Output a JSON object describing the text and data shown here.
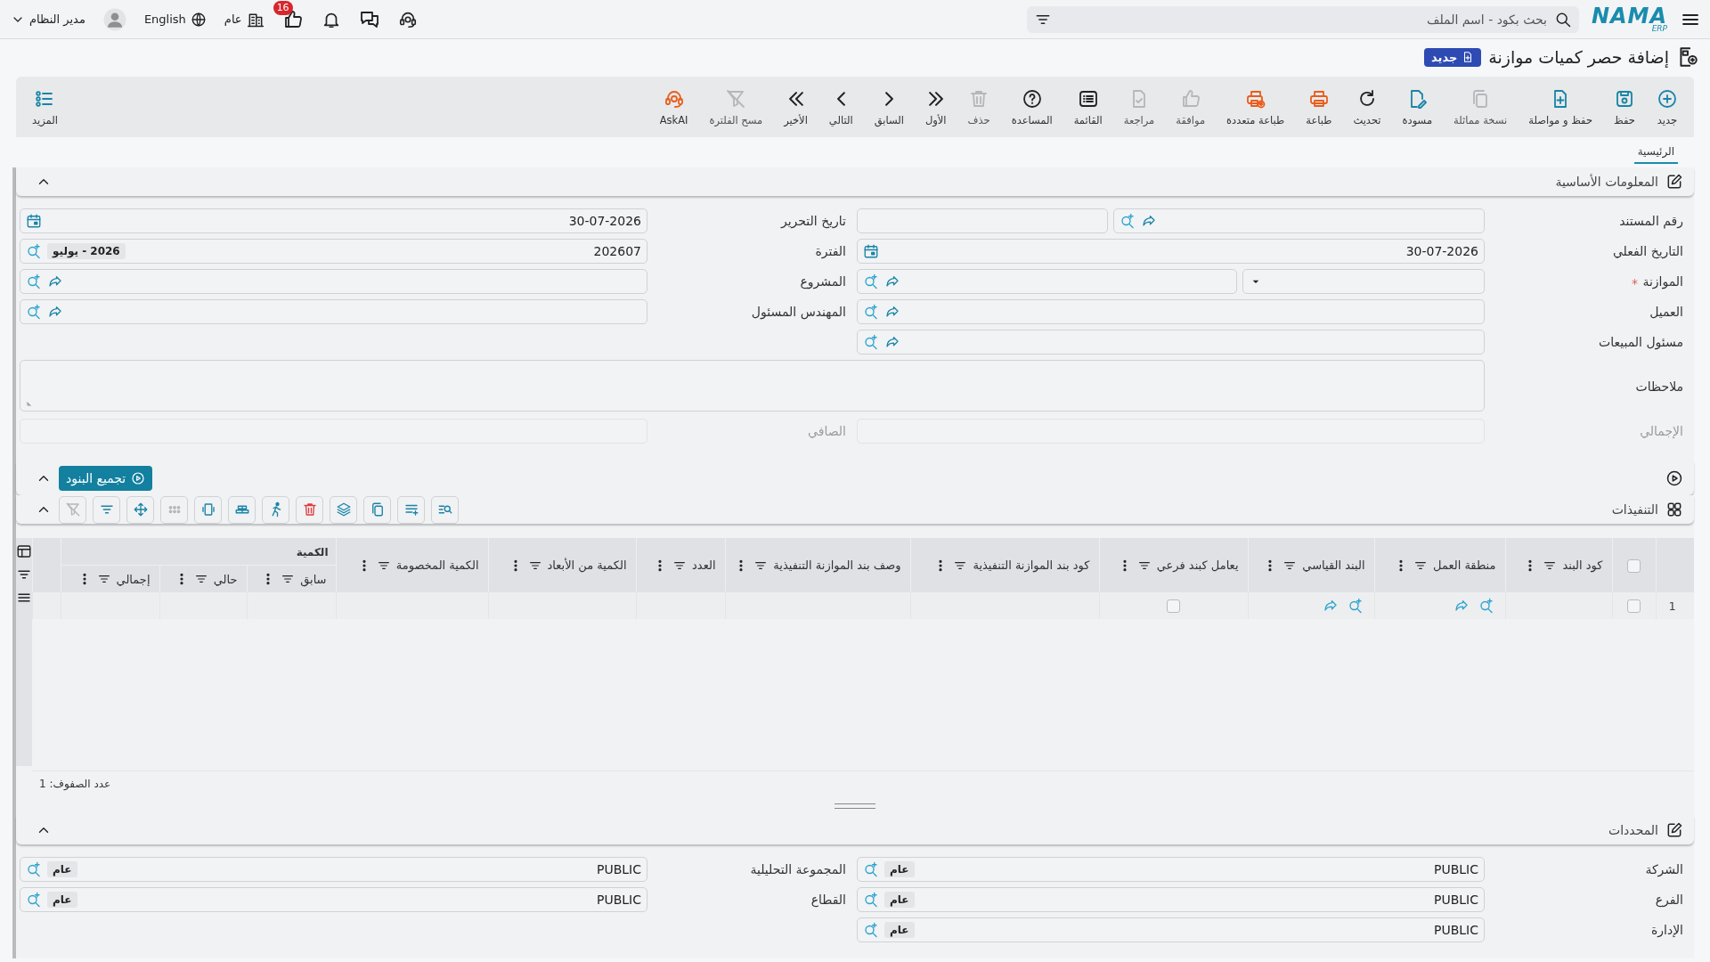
{
  "topbar": {
    "logo": {
      "name": "NAMA",
      "sub": "ERP"
    },
    "search": {
      "placeholder": "بحث بكود - اسم الملف"
    },
    "notifications": {
      "count": "16"
    },
    "branch": {
      "label": "عام"
    },
    "language": {
      "label": "English"
    },
    "user": {
      "name": "مدير النظام"
    }
  },
  "page": {
    "title": "إضافة حصر كميات موازنة",
    "status": "جديد"
  },
  "toolbar": [
    {
      "kind": "new",
      "label": "جديد",
      "disabled": false
    },
    {
      "kind": "save",
      "label": "حفظ",
      "disabled": false
    },
    {
      "kind": "savecont",
      "label": "حفظ و مواصلة",
      "disabled": false
    },
    {
      "kind": "copy",
      "label": "نسخة مماثلة",
      "disabled": true
    },
    {
      "kind": "draft",
      "label": "مسودة",
      "disabled": false
    },
    {
      "kind": "refresh",
      "label": "تحديث",
      "disabled": false
    },
    {
      "kind": "print",
      "label": "طباعة",
      "disabled": false
    },
    {
      "kind": "printm",
      "label": "طباعة متعددة",
      "disabled": false
    },
    {
      "kind": "approve",
      "label": "موافقة",
      "disabled": true
    },
    {
      "kind": "review",
      "label": "مراجعة",
      "disabled": true
    },
    {
      "kind": "list",
      "label": "القائمة",
      "disabled": false
    },
    {
      "kind": "help",
      "label": "المساعدة",
      "disabled": false
    },
    {
      "kind": "delete",
      "label": "حذف",
      "disabled": true
    },
    {
      "kind": "first",
      "label": "الأول",
      "disabled": false
    },
    {
      "kind": "prev",
      "label": "السابق",
      "disabled": false
    },
    {
      "kind": "next",
      "label": "التالي",
      "disabled": false
    },
    {
      "kind": "last",
      "label": "الأخير",
      "disabled": false
    },
    {
      "kind": "clearfilter",
      "label": "مسح الفلترة",
      "disabled": true
    },
    {
      "kind": "askai",
      "label": "AskAI",
      "disabled": false
    }
  ],
  "more": {
    "label": "المزيد"
  },
  "tabs": [
    {
      "label": "الرئيسية",
      "selected": true
    }
  ],
  "basic_info": {
    "title": "المعلومات الأساسية",
    "expanded": true,
    "rows": [
      [
        {
          "kind": "docnum",
          "label": "رقم المستند",
          "required": false,
          "disabled": false,
          "linkable": true
        },
        {
          "kind": "date",
          "label": "تاريخ التحرير",
          "value": "30-07-2026",
          "required": false,
          "disabled": false
        }
      ],
      [
        {
          "kind": "date",
          "label": "التاريخ الفعلي",
          "value": "30-07-2026",
          "required": false,
          "disabled": false
        },
        {
          "kind": "lookup",
          "label": "الفترة",
          "value": "202607",
          "tag": "2026 - يوليو",
          "required": false,
          "disabled": false,
          "linkable": false
        }
      ],
      [
        {
          "kind": "select-lookup",
          "label": "الموازنة",
          "required": true,
          "disabled": false,
          "linkable": true
        },
        {
          "kind": "lookup",
          "label": "المشروع",
          "required": false,
          "disabled": false,
          "linkable": true
        }
      ],
      [
        {
          "kind": "lookup",
          "label": "العميل",
          "required": false,
          "disabled": false,
          "linkable": true
        },
        {
          "kind": "lookup",
          "label": "المهندس المسئول",
          "required": false,
          "disabled": false,
          "linkable": true
        }
      ],
      [
        {
          "kind": "lookup",
          "label": "مسئول المبيعات",
          "required": false,
          "disabled": false,
          "linkable": true
        }
      ],
      [
        {
          "kind": "textarea",
          "label": "ملاحظات",
          "required": false,
          "disabled": false
        }
      ],
      [
        {
          "kind": "readonly",
          "label": "الإجمالي",
          "required": false,
          "disabled": true
        },
        {
          "kind": "readonly",
          "label": "الصافي",
          "required": false,
          "disabled": true
        }
      ]
    ]
  },
  "collect": {
    "button": "تجميع البنود",
    "expanded": true
  },
  "executions": {
    "title": "التنفيذات",
    "expanded": true,
    "tools": [
      {
        "kind": "searchlist",
        "disabled": false
      },
      {
        "kind": "listadd",
        "disabled": false
      },
      {
        "kind": "copy",
        "disabled": false
      },
      {
        "kind": "layers",
        "disabled": false
      },
      {
        "kind": "trash",
        "disabled": false
      },
      {
        "kind": "runner",
        "disabled": false
      },
      {
        "kind": "rows",
        "disabled": false
      },
      {
        "kind": "columns",
        "disabled": false
      },
      {
        "kind": "dots",
        "disabled": true
      },
      {
        "kind": "move",
        "disabled": false
      },
      {
        "kind": "filterlines",
        "disabled": false
      },
      {
        "kind": "clearfilter",
        "disabled": true
      }
    ],
    "select_all": {
      "checked": false
    },
    "columns": [
      {
        "label": "كود البند"
      },
      {
        "label": "منطقة العمل"
      },
      {
        "label": "البند القياسي"
      },
      {
        "label": "يعامل كبند فرعي"
      },
      {
        "label": "كود بند الموازنة التنفيذية"
      },
      {
        "label": "وصف بند الموازنة التنفيذية"
      },
      {
        "label": "العدد"
      },
      {
        "label": "الكمية من الأبعاد"
      },
      {
        "label": "الكمية المخصومة"
      },
      {
        "label": "الكمية",
        "children": [
          {
            "label": "سابق"
          },
          {
            "label": "حالي"
          },
          {
            "label": "إجمالي"
          }
        ]
      }
    ],
    "rows": [
      {
        "number": "1",
        "selected": false,
        "cells": [
          {
            "kind": "empty"
          },
          {
            "kind": "lookup"
          },
          {
            "kind": "lookup"
          },
          {
            "kind": "checkbox",
            "checked": false
          },
          {
            "kind": "empty"
          },
          {
            "kind": "empty"
          },
          {
            "kind": "empty"
          },
          {
            "kind": "empty"
          },
          {
            "kind": "empty"
          },
          {
            "kind": "empty"
          },
          {
            "kind": "empty"
          },
          {
            "kind": "empty"
          }
        ]
      }
    ],
    "footer": "عدد الصفوف: 1"
  },
  "restrictions": {
    "title": "المحددات",
    "expanded": true,
    "rows": [
      [
        {
          "kind": "lookup",
          "label": "الشركة",
          "value": "PUBLIC",
          "tag": "عام",
          "required": false,
          "disabled": false,
          "linkable": false
        },
        {
          "kind": "lookup",
          "label": "المجموعة التحليلية",
          "value": "PUBLIC",
          "tag": "عام",
          "required": false,
          "disabled": false,
          "linkable": false
        }
      ],
      [
        {
          "kind": "lookup",
          "label": "الفرع",
          "value": "PUBLIC",
          "tag": "عام",
          "required": false,
          "disabled": false,
          "linkable": false
        },
        {
          "kind": "lookup",
          "label": "القطاع",
          "value": "PUBLIC",
          "tag": "عام",
          "required": false,
          "disabled": false,
          "linkable": false
        }
      ],
      [
        {
          "kind": "lookup",
          "label": "الإدارة",
          "value": "PUBLIC",
          "tag": "عام",
          "required": false,
          "disabled": false,
          "linkable": false
        }
      ]
    ]
  }
}
